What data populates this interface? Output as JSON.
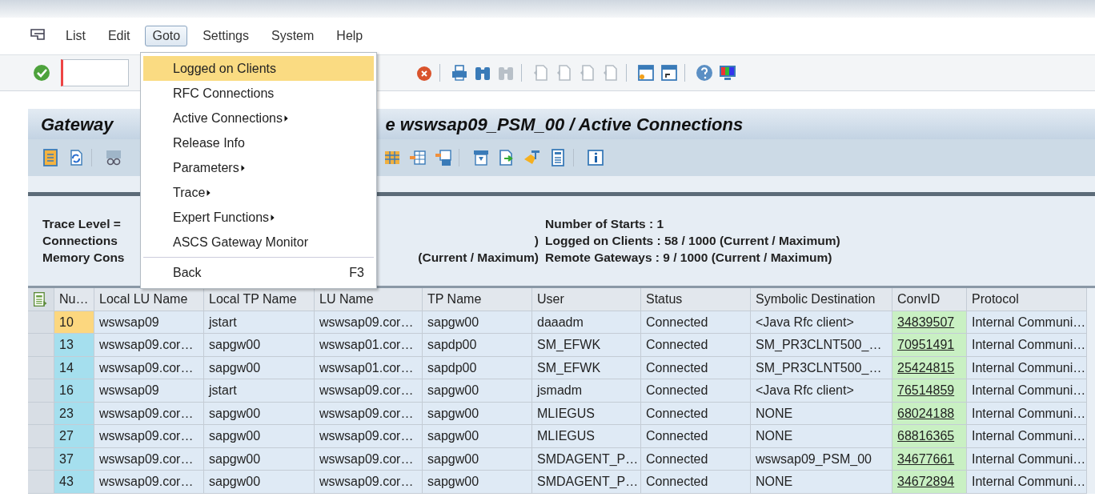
{
  "menu_bar": [
    {
      "label": "List",
      "selected": false
    },
    {
      "label": "Edit",
      "selected": false
    },
    {
      "label": "Goto",
      "selected": true
    },
    {
      "label": "Settings",
      "selected": false
    },
    {
      "label": "System",
      "selected": false
    },
    {
      "label": "Help",
      "selected": false
    }
  ],
  "dropdown": {
    "items": [
      {
        "label": "Logged on Clients",
        "selected": true,
        "submenu": false
      },
      {
        "label": "RFC Connections",
        "selected": false,
        "submenu": false
      },
      {
        "label": "Active Connections",
        "selected": false,
        "submenu": true
      },
      {
        "label": "Release Info",
        "selected": false,
        "submenu": false
      },
      {
        "label": "Parameters",
        "selected": false,
        "submenu": true
      },
      {
        "label": "Trace",
        "selected": false,
        "submenu": true
      },
      {
        "label": "Expert Functions",
        "selected": false,
        "submenu": true
      },
      {
        "label": "ASCS Gateway Monitor",
        "selected": false,
        "submenu": false
      },
      {
        "label": "Back",
        "selected": false,
        "submenu": false,
        "shortcut": "F3",
        "separator_before": true
      }
    ]
  },
  "title": {
    "left": "Gateway",
    "right": "e wswsap09_PSM_00 / Active Connections"
  },
  "info": {
    "left": [
      "Trace Level =",
      "Connections",
      "Memory Cons"
    ],
    "middle": [
      ")",
      "(Current / Maximum)"
    ],
    "right": [
      "Number of Starts : 1",
      "Logged on Clients : 58 / 1000 (Current / Maximum)",
      "Remote Gateways : 9 / 1000 (Current / Maximum)"
    ]
  },
  "table": {
    "columns": [
      "Nu…",
      "Local LU Name",
      "Local TP Name",
      "LU Name",
      "TP Name",
      "User",
      "Status",
      "Symbolic Destination",
      "ConvID",
      "Protocol"
    ],
    "rows": [
      {
        "selected": true,
        "cells": [
          "10",
          "wswsap09",
          "jstart",
          "wswsap09.cor…",
          "sapgw00",
          "daaadm",
          "Connected",
          "<Java Rfc client>",
          "34839507",
          "Internal Communi…"
        ]
      },
      {
        "selected": false,
        "cells": [
          "13",
          "wswsap09.cor…",
          "sapgw00",
          "wswsap01.cor…",
          "sapdp00",
          "SM_EFWK",
          "Connected",
          "SM_PR3CLNT500_…",
          "70951491",
          "Internal Communi…"
        ]
      },
      {
        "selected": false,
        "cells": [
          "14",
          "wswsap09.cor…",
          "sapgw00",
          "wswsap01.cor…",
          "sapdp00",
          "SM_EFWK",
          "Connected",
          "SM_PR3CLNT500_…",
          "25424815",
          "Internal Communi…"
        ]
      },
      {
        "selected": false,
        "cells": [
          "16",
          "wswsap09",
          "jstart",
          "wswsap09.cor…",
          "sapgw00",
          "jsmadm",
          "Connected",
          "<Java Rfc client>",
          "76514859",
          "Internal Communi…"
        ]
      },
      {
        "selected": false,
        "cells": [
          "23",
          "wswsap09.cor…",
          "sapgw00",
          "wswsap09.cor…",
          "sapgw00",
          "MLIEGUS",
          "Connected",
          "NONE",
          "68024188",
          "Internal Communi…"
        ]
      },
      {
        "selected": false,
        "cells": [
          "27",
          "wswsap09.cor…",
          "sapgw00",
          "wswsap09.cor…",
          "sapgw00",
          "MLIEGUS",
          "Connected",
          "NONE",
          "68816365",
          "Internal Communi…"
        ]
      },
      {
        "selected": false,
        "cells": [
          "37",
          "wswsap09.cor…",
          "sapgw00",
          "wswsap09.cor…",
          "sapgw00",
          "SMDAGENT_P…",
          "Connected",
          "wswsap09_PSM_00",
          "34677661",
          "Internal Communi…"
        ]
      },
      {
        "selected": false,
        "cells": [
          "43",
          "wswsap09.cor…",
          "sapgw00",
          "wswsap09.cor…",
          "sapgw00",
          "SMDAGENT_P…",
          "Connected",
          "NONE",
          "34672894",
          "Internal Communi…"
        ]
      }
    ]
  }
}
